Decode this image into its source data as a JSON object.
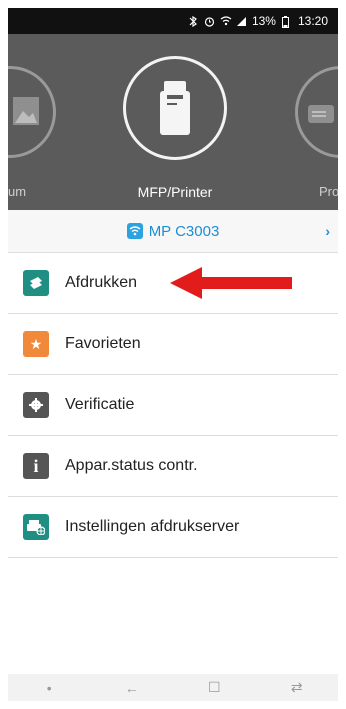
{
  "status_bar": {
    "battery": "13%",
    "time": "13:20",
    "icons": [
      "bluetooth-icon",
      "alarm-icon",
      "wifi-icon",
      "signal-icon",
      "battery-icon"
    ]
  },
  "carousel": {
    "left_label": "um",
    "center_label": "MFP/Printer",
    "right_label": "Pro",
    "left_icon": "image-icon",
    "center_icon": "printer-icon",
    "right_icon": "projector-icon"
  },
  "printer": {
    "name": "MP C3003",
    "icon": "wifi-icon",
    "chevron": "›"
  },
  "menu": {
    "items": [
      {
        "label": "Afdrukken",
        "icon": "print-doc-icon",
        "color": "#1f8f84"
      },
      {
        "label": "Favorieten",
        "icon": "star-icon",
        "color": "#f08a3a"
      },
      {
        "label": "Verificatie",
        "icon": "gear-icon",
        "color": "#555555"
      },
      {
        "label": "Appar.status contr.",
        "icon": "info-icon",
        "color": "#555555"
      },
      {
        "label": "Instellingen afdrukserver",
        "icon": "print-server-icon",
        "color": "#1f8f84"
      }
    ]
  },
  "nav": {
    "dot": "•",
    "back": "←",
    "home": "☐",
    "recent": "⇄"
  },
  "colors": {
    "header_bg": "#5b5b5b",
    "accent_blue": "#1d8ed4",
    "annotation_red": "#e21b1b"
  }
}
